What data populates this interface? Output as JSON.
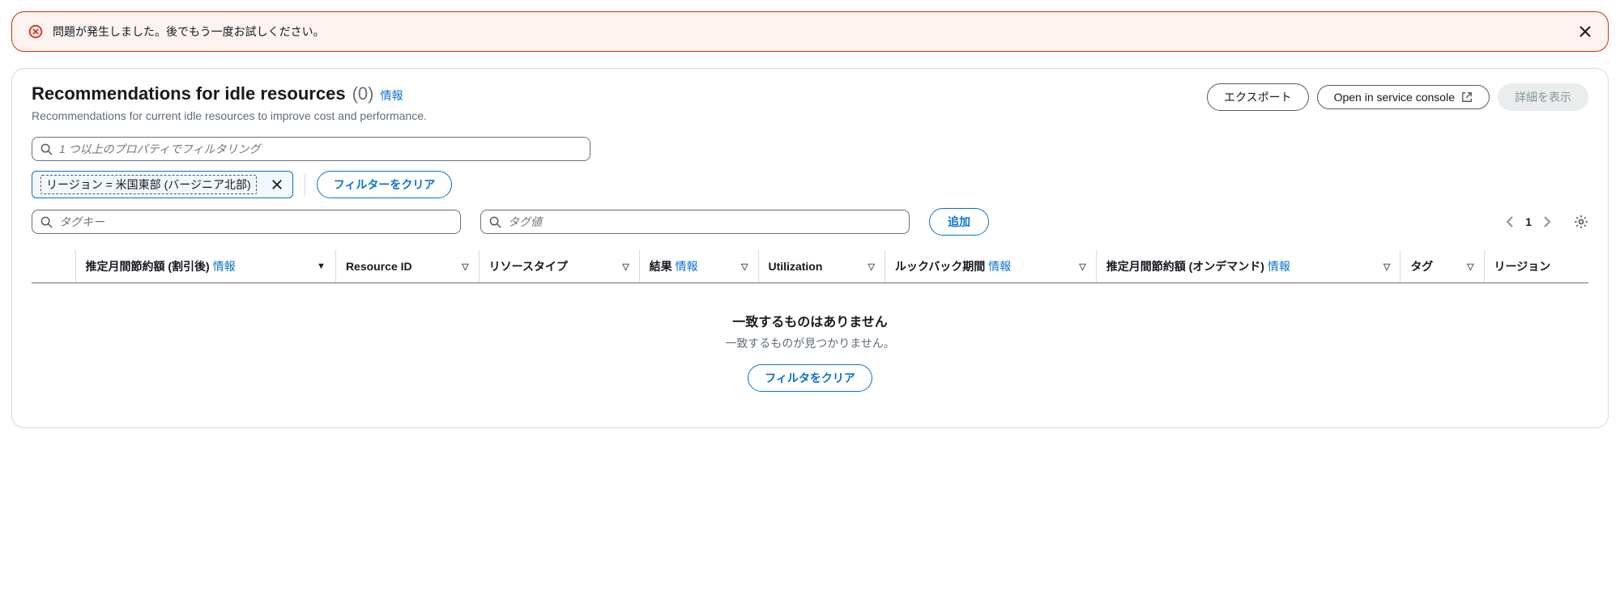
{
  "error": {
    "message": "問題が発生しました。後でもう一度お試しください。"
  },
  "header": {
    "title": "Recommendations for idle resources",
    "count": "(0)",
    "info_label": "情報",
    "subtitle": "Recommendations for current idle resources to improve cost and performance.",
    "export_button": "エクスポート",
    "open_console_button": "Open in service console",
    "details_button": "詳細を表示"
  },
  "filters": {
    "main_placeholder": "1 つ以上のプロパティでフィルタリング",
    "chip_text": "リージョン = 米国東部 (バージニア北部)",
    "clear_button": "フィルターをクリア",
    "tag_key_placeholder": "タグキー",
    "tag_value_placeholder": "タグ値",
    "add_button": "追加"
  },
  "pagination": {
    "page": "1"
  },
  "columns": {
    "c1_label": "推定月間節約額 (割引後)",
    "c1_info": "情報",
    "c2_label": "Resource ID",
    "c3_label": "リソースタイプ",
    "c4_label": "結果",
    "c4_info": "情報",
    "c5_label": "Utilization",
    "c6_label": "ルックバック期間",
    "c6_info": "情報",
    "c7_label": "推定月間節約額 (オンデマンド)",
    "c7_info": "情報",
    "c8_label": "タグ",
    "c9_label": "リージョン"
  },
  "empty": {
    "title": "一致するものはありません",
    "subtitle": "一致するものが見つかりません。",
    "clear_button": "フィルタをクリア"
  }
}
